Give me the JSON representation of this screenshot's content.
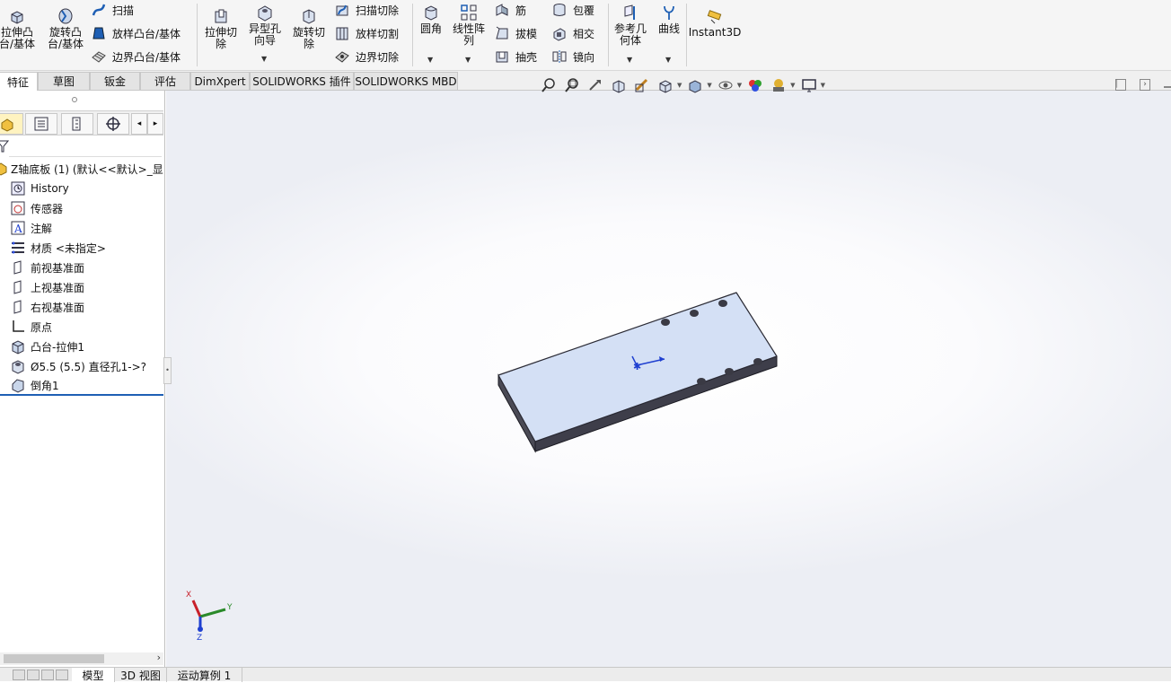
{
  "ribbon": {
    "extrude_boss": "拉伸凸台/基体",
    "revolve_boss": "旋转凸台/基体",
    "sweep": "扫描",
    "loft_boss": "放样凸台/基体",
    "boundary_boss": "边界凸台/基体",
    "extrude_cut": "拉伸切除",
    "hole_wizard": "异型孔向导",
    "revolve_cut": "旋转切除",
    "sweep_cut": "扫描切除",
    "loft_cut": "放样切割",
    "boundary_cut": "边界切除",
    "fillet": "圆角",
    "linear_pattern": "线性阵列",
    "rib": "筋",
    "draft": "拔模",
    "shell": "抽壳",
    "wrap": "包覆",
    "intersect": "相交",
    "mirror": "镜向",
    "ref_geometry": "参考几何体",
    "curves": "曲线",
    "instant3d": "Instant3D"
  },
  "tabs": [
    "特征",
    "草图",
    "钣金",
    "评估",
    "DimXpert",
    "SOLIDWORKS 插件",
    "SOLIDWORKS MBD"
  ],
  "tree": {
    "part": "Z轴底板 (1)  (默认<<默认>_显",
    "items": [
      "History",
      "传感器",
      "注解",
      "材质 <未指定>",
      "前视基准面",
      "上视基准面",
      "右视基准面",
      "原点",
      "凸台-拉伸1",
      "Ø5.5 (5.5) 直径孔1->?",
      "倒角1"
    ]
  },
  "bottom_tabs": [
    "模型",
    "3D 视图",
    "运动算例 1"
  ],
  "axes": {
    "x": "X",
    "y": "Y",
    "z": "Z"
  },
  "colors": {
    "part_face": "#d4e0f5",
    "part_side": "#3e3e4a",
    "accent_blue": "#1e5fb4"
  }
}
